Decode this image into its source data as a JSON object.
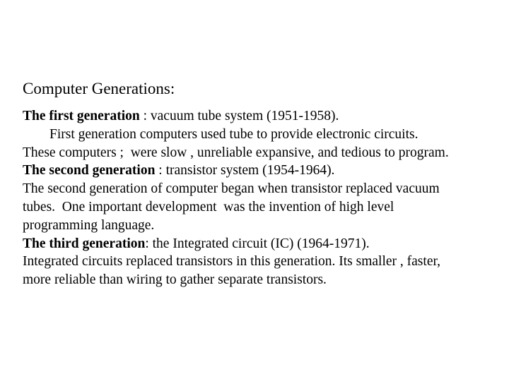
{
  "slide": {
    "title": "Computer Generations:",
    "background_color": "#ffffff",
    "text_color": "#000000",
    "lines": [
      {
        "id": "line-first-generation",
        "bold_lead": "The first generation",
        "rest": " : vacuum tube system (1951-1958).",
        "indent": false
      },
      {
        "id": "line-first-generation-detail",
        "bold_lead": "",
        "rest": "First generation computers used tube to provide electronic circuits.",
        "indent": true
      },
      {
        "id": "line-first-generation-traits",
        "bold_lead": "",
        "rest": "These computers ;  were slow , unreliable expansive, and tedious to program.",
        "indent": false
      },
      {
        "id": "line-second-generation",
        "bold_lead": "The second generation",
        "rest": " : transistor system (1954-1964).",
        "indent": false
      },
      {
        "id": "line-second-generation-detail-1",
        "bold_lead": "",
        "rest": "The second generation of computer began when transistor replaced vacuum",
        "indent": false
      },
      {
        "id": "line-second-generation-detail-2",
        "bold_lead": "",
        "rest": "tubes.  One important development  was the invention of high level",
        "indent": false
      },
      {
        "id": "line-second-generation-detail-3",
        "bold_lead": "",
        "rest": "programming language.",
        "indent": false
      },
      {
        "id": "line-third-generation",
        "bold_lead": "The third generation",
        "rest": ": the Integrated circuit (IC) (1964-1971).",
        "indent": false
      },
      {
        "id": "line-third-generation-detail-1",
        "bold_lead": "",
        "rest": "Integrated circuits replaced transistors in this generation. Its smaller , faster,",
        "indent": false
      },
      {
        "id": "line-third-generation-detail-2",
        "bold_lead": "",
        "rest": "more reliable than wiring to gather separate transistors.",
        "indent": false
      }
    ]
  }
}
